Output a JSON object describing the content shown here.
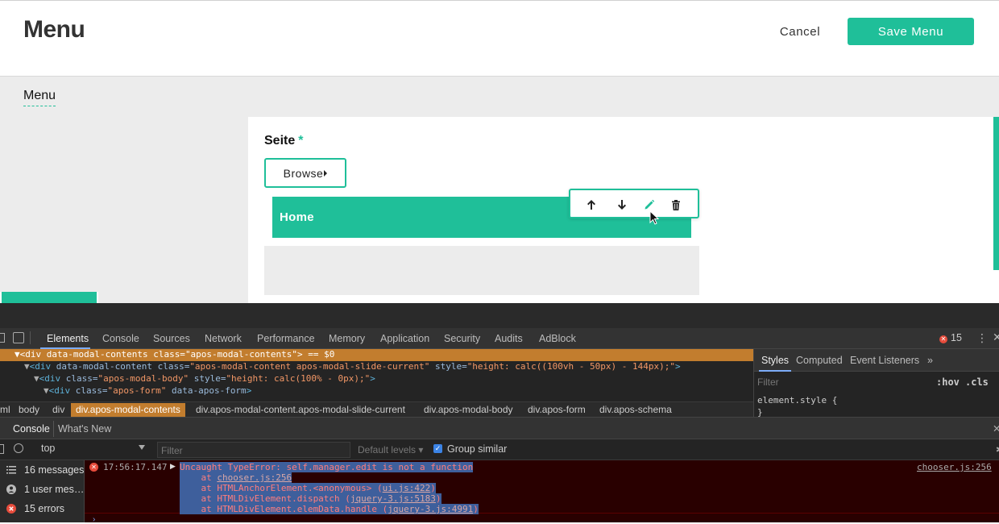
{
  "modal": {
    "title": "Menu",
    "cancel_label": "Cancel",
    "save_label": "Save Menu",
    "tab_label": "Menu",
    "field_label": "Seite",
    "required_mark": "*",
    "browse_label": "Browse",
    "chosen_item_label": "Home",
    "accent_color": "#1fbf99"
  },
  "devtools": {
    "tabs": [
      "Elements",
      "Console",
      "Sources",
      "Network",
      "Performance",
      "Memory",
      "Application",
      "Security",
      "Audits",
      "AdBlock"
    ],
    "error_count": "15",
    "elements_lines": {
      "l1_tag": "<div",
      "l1_attr": " data-modal-contents class=",
      "l1_val": "\"apos-modal-contents\"",
      "l1_end": "> == $0",
      "l2_tag": "<div",
      "l2_attr": " data-modal-content class=",
      "l2_val": "\"apos-modal-content apos-modal-slide-current\"",
      "l2_attr2": " style=",
      "l2_val2": "\"height: calc((100vh - 50px) - 144px);\"",
      "l2_end": ">",
      "l3_tag": "<div",
      "l3_attr": " class=",
      "l3_val": "\"apos-modal-body\"",
      "l3_attr2": " style=",
      "l3_val2": "\"height: calc(100% - 0px);\"",
      "l3_end": ">",
      "l4_tag": "<div",
      "l4_attr": " class=",
      "l4_val": "\"apos-form\"",
      "l4_attr2": " data-apos-form",
      "l4_end": ">"
    },
    "breadcrumbs": [
      "ml",
      "body",
      "div",
      "div.apos-modal-contents",
      "div.apos-modal-content.apos-modal-slide-current",
      "div.apos-modal-body",
      "div.apos-form",
      "div.apos-schema"
    ],
    "styles_tabs": [
      "Styles",
      "Computed",
      "Event Listeners",
      "»"
    ],
    "styles_filter_placeholder": "Filter",
    "hov_label": ":hov",
    "cls_label": ".cls",
    "element_style_open": "element.style {",
    "element_style_close": "}",
    "console_tabs": [
      "Console",
      "What's New"
    ],
    "context": "top",
    "console_filter_placeholder": "Filter",
    "default_levels": "Default levels ▾",
    "group_similar": "Group similar",
    "sidebar": {
      "messages": "16 messages",
      "user_messages": "1 user mes…",
      "errors": "15 errors"
    },
    "log": {
      "time": "17:56:17.147",
      "line1": "Uncaught TypeError: self.manager.edit is not a function",
      "line2_prefix": "    at ",
      "line2_link": "chooser.js:256",
      "line3_prefix": "    at HTMLAnchorElement.<anonymous> (",
      "line3_link": "ui.js:422",
      "line4_prefix": "    at HTMLDivElement.dispatch (",
      "line4_link": "jquery-3.js:5183",
      "line5_prefix": "    at HTMLDivElement.elemData.handle (",
      "line5_link": "jquery-3.js:4991",
      "close_paren": ")",
      "source": "chooser.js:256"
    }
  }
}
